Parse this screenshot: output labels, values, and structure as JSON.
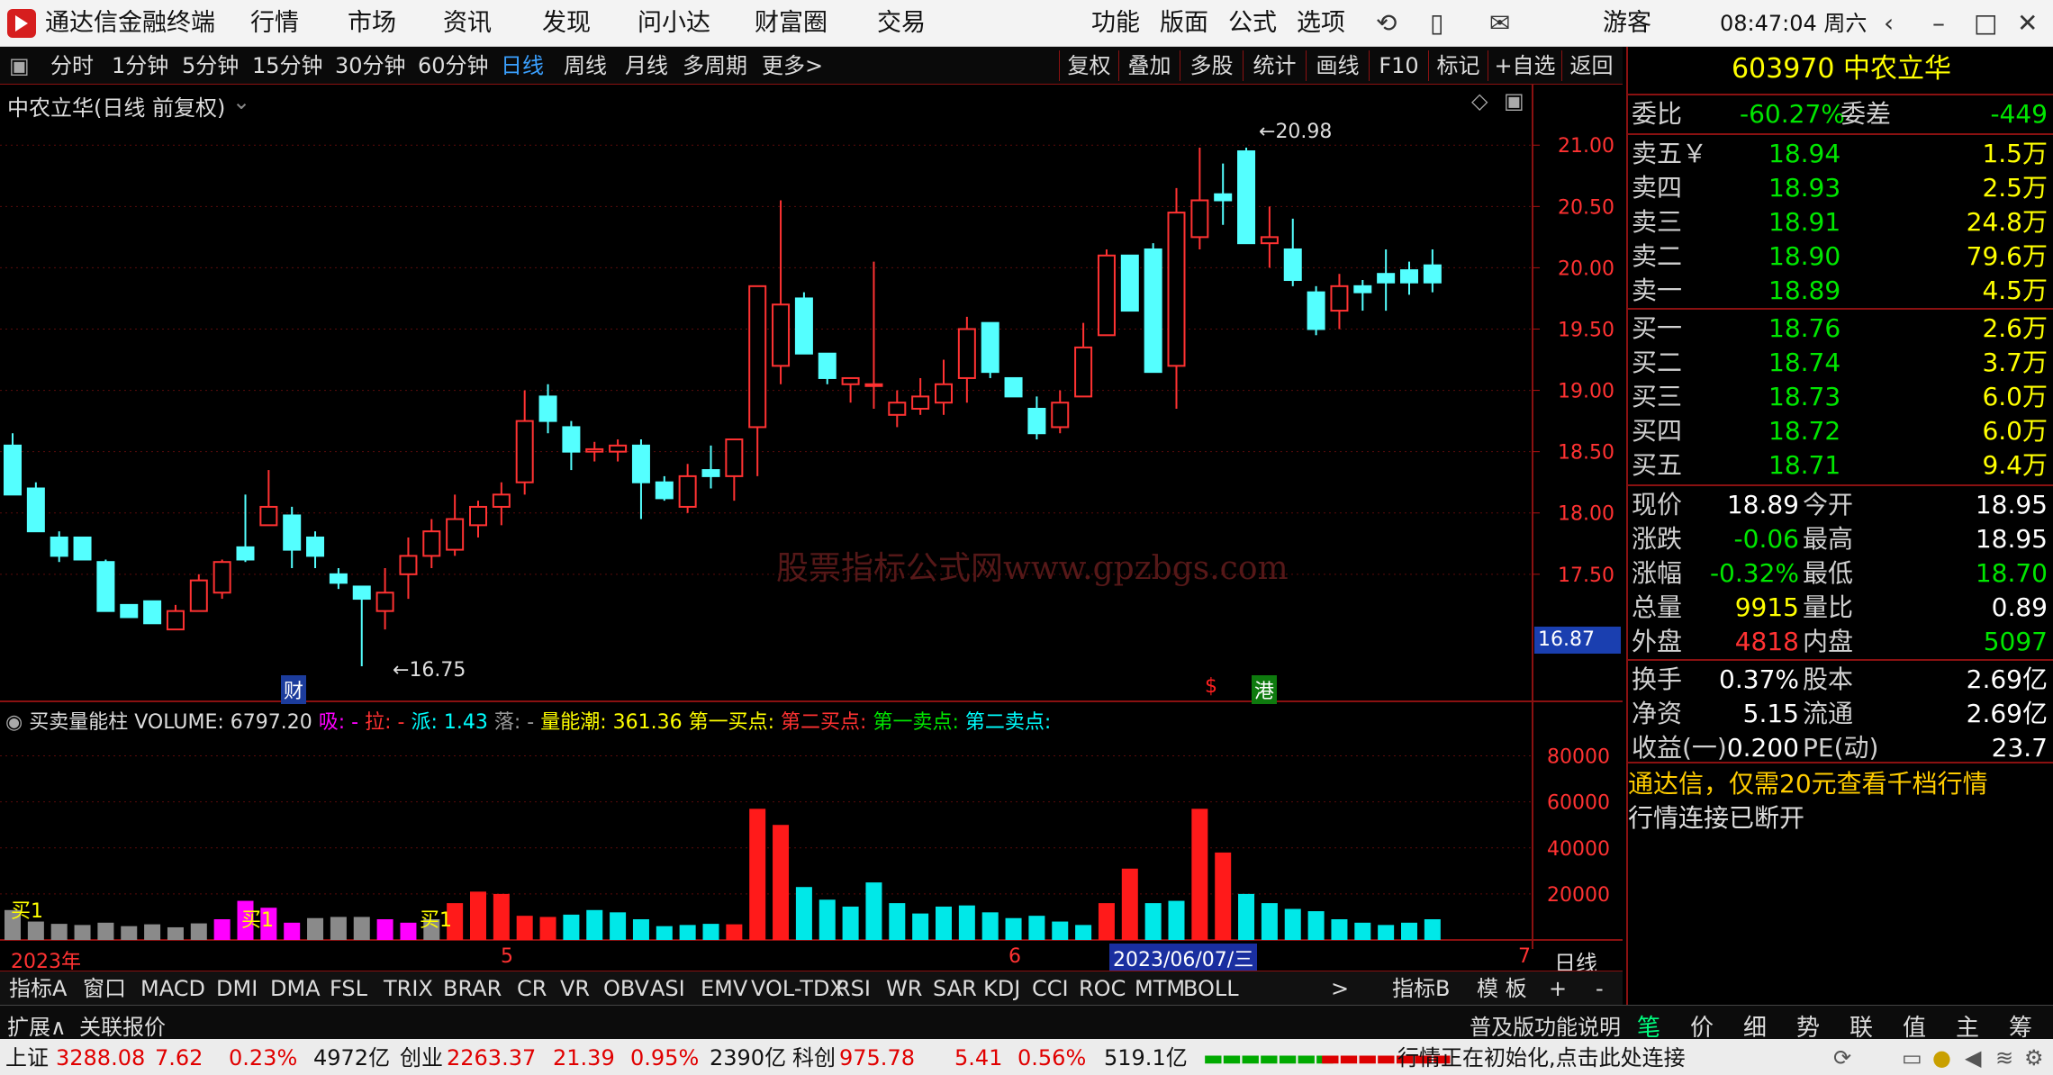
{
  "app": {
    "title": "通达信金融终端",
    "menu": [
      "行情",
      "市场",
      "资讯",
      "发现",
      "问小达",
      "财富圈",
      "交易"
    ],
    "right_menu": [
      "功能",
      "版面",
      "公式",
      "选项"
    ],
    "user": "游客",
    "clock": "08:47:04 周六"
  },
  "toolbar": {
    "periods": [
      "分时",
      "1分钟",
      "5分钟",
      "15分钟",
      "30分钟",
      "60分钟",
      "日线",
      "周线",
      "月线",
      "多周期",
      "更多>"
    ],
    "active_period": "日线",
    "buttons": [
      "复权",
      "叠加",
      "多股",
      "统计",
      "画线",
      "F10",
      "标记",
      "+自选",
      "返回"
    ]
  },
  "chart": {
    "title": "中农立华(日线 前复权)",
    "high_label": "20.98",
    "low_label": "16.75",
    "cursor_price": "16.87",
    "watermark": "股票指标公式网www.gpzbgs.com",
    "markers": {
      "cai": "财",
      "dollar": "$",
      "gang": "港"
    },
    "price_ticks": [
      "21.00",
      "20.50",
      "20.00",
      "19.50",
      "19.00",
      "18.50",
      "18.00",
      "17.50"
    ],
    "volume_ticks": [
      "80000",
      "60000",
      "40000",
      "20000"
    ],
    "date_labels": {
      "year": "2023年",
      "m5": "5",
      "m6": "6",
      "cursor_date": "2023/06/07/三",
      "m7": "7"
    },
    "period_tag": "日线"
  },
  "indicator": {
    "name": "买卖量能柱",
    "volume_label": "VOLUME: 6797.20",
    "xi": "吸: -",
    "la": "拉: -",
    "pai": "派: 1.43",
    "luo": "落: -",
    "lnc": "量能潮: 361.36",
    "b1": "第一买点:",
    "b2": "第二买点:",
    "s1": "第一卖点:",
    "s2": "第二卖点:",
    "buy_tag": "买1"
  },
  "chart_data": {
    "type": "candlestick",
    "title": "中农立华(日线 前复权)",
    "ylim": [
      16.5,
      21.2
    ],
    "candles": [
      {
        "o": 18.55,
        "h": 18.65,
        "l": 18.15,
        "c": 18.15
      },
      {
        "o": 18.2,
        "h": 18.25,
        "l": 17.85,
        "c": 17.85
      },
      {
        "o": 17.8,
        "h": 17.85,
        "l": 17.6,
        "c": 17.65
      },
      {
        "o": 17.8,
        "h": 17.8,
        "l": 17.62,
        "c": 17.62
      },
      {
        "o": 17.6,
        "h": 17.62,
        "l": 17.2,
        "c": 17.2
      },
      {
        "o": 17.25,
        "h": 17.25,
        "l": 17.15,
        "c": 17.15
      },
      {
        "o": 17.28,
        "h": 17.28,
        "l": 17.1,
        "c": 17.1
      },
      {
        "o": 17.05,
        "h": 17.25,
        "l": 17.05,
        "c": 17.2
      },
      {
        "o": 17.2,
        "h": 17.5,
        "l": 17.2,
        "c": 17.45
      },
      {
        "o": 17.35,
        "h": 17.62,
        "l": 17.3,
        "c": 17.6
      },
      {
        "o": 17.72,
        "h": 18.15,
        "l": 17.6,
        "c": 17.62
      },
      {
        "o": 17.9,
        "h": 18.35,
        "l": 17.9,
        "c": 18.05
      },
      {
        "o": 17.98,
        "h": 18.05,
        "l": 17.55,
        "c": 17.7
      },
      {
        "o": 17.8,
        "h": 17.85,
        "l": 17.55,
        "c": 17.65
      },
      {
        "o": 17.5,
        "h": 17.55,
        "l": 17.38,
        "c": 17.43
      },
      {
        "o": 17.4,
        "h": 17.4,
        "l": 16.75,
        "c": 17.3
      },
      {
        "o": 17.2,
        "h": 17.55,
        "l": 17.05,
        "c": 17.35
      },
      {
        "o": 17.5,
        "h": 17.8,
        "l": 17.3,
        "c": 17.65
      },
      {
        "o": 17.65,
        "h": 17.95,
        "l": 17.55,
        "c": 17.85
      },
      {
        "o": 17.7,
        "h": 18.15,
        "l": 17.65,
        "c": 17.95
      },
      {
        "o": 17.9,
        "h": 18.1,
        "l": 17.8,
        "c": 18.05
      },
      {
        "o": 18.05,
        "h": 18.25,
        "l": 17.9,
        "c": 18.15
      },
      {
        "o": 18.25,
        "h": 19.0,
        "l": 18.15,
        "c": 18.75
      },
      {
        "o": 18.95,
        "h": 19.05,
        "l": 18.65,
        "c": 18.75
      },
      {
        "o": 18.7,
        "h": 18.75,
        "l": 18.35,
        "c": 18.5
      },
      {
        "o": 18.5,
        "h": 18.58,
        "l": 18.42,
        "c": 18.52
      },
      {
        "o": 18.5,
        "h": 18.6,
        "l": 18.42,
        "c": 18.55
      },
      {
        "o": 18.55,
        "h": 18.6,
        "l": 17.95,
        "c": 18.25
      },
      {
        "o": 18.25,
        "h": 18.3,
        "l": 18.1,
        "c": 18.12
      },
      {
        "o": 18.05,
        "h": 18.4,
        "l": 18.0,
        "c": 18.3
      },
      {
        "o": 18.35,
        "h": 18.55,
        "l": 18.2,
        "c": 18.3
      },
      {
        "o": 18.3,
        "h": 18.6,
        "l": 18.1,
        "c": 18.6
      },
      {
        "o": 18.7,
        "h": 19.85,
        "l": 18.3,
        "c": 19.85
      },
      {
        "o": 19.2,
        "h": 20.55,
        "l": 19.05,
        "c": 19.7
      },
      {
        "o": 19.75,
        "h": 19.8,
        "l": 19.3,
        "c": 19.3
      },
      {
        "o": 19.3,
        "h": 19.3,
        "l": 19.05,
        "c": 19.1
      },
      {
        "o": 19.05,
        "h": 19.1,
        "l": 18.9,
        "c": 19.1
      },
      {
        "o": 19.05,
        "h": 20.05,
        "l": 18.85,
        "c": 19.05
      },
      {
        "o": 18.8,
        "h": 19.0,
        "l": 18.7,
        "c": 18.9
      },
      {
        "o": 18.85,
        "h": 19.1,
        "l": 18.8,
        "c": 18.95
      },
      {
        "o": 18.9,
        "h": 19.25,
        "l": 18.8,
        "c": 19.05
      },
      {
        "o": 19.1,
        "h": 19.6,
        "l": 18.9,
        "c": 19.5
      },
      {
        "o": 19.55,
        "h": 19.55,
        "l": 19.1,
        "c": 19.15
      },
      {
        "o": 19.1,
        "h": 19.1,
        "l": 18.95,
        "c": 18.95
      },
      {
        "o": 18.85,
        "h": 18.95,
        "l": 18.6,
        "c": 18.65
      },
      {
        "o": 18.7,
        "h": 19.0,
        "l": 18.65,
        "c": 18.9
      },
      {
        "o": 18.95,
        "h": 19.55,
        "l": 18.95,
        "c": 19.35
      },
      {
        "o": 19.45,
        "h": 20.15,
        "l": 19.45,
        "c": 20.1
      },
      {
        "o": 20.1,
        "h": 20.1,
        "l": 19.65,
        "c": 19.65
      },
      {
        "o": 20.15,
        "h": 20.2,
        "l": 19.15,
        "c": 19.15
      },
      {
        "o": 19.2,
        "h": 20.65,
        "l": 18.85,
        "c": 20.45
      },
      {
        "o": 20.25,
        "h": 20.98,
        "l": 20.15,
        "c": 20.55
      },
      {
        "o": 20.6,
        "h": 20.85,
        "l": 20.35,
        "c": 20.55
      },
      {
        "o": 20.95,
        "h": 20.98,
        "l": 20.2,
        "c": 20.2
      },
      {
        "o": 20.2,
        "h": 20.5,
        "l": 20.0,
        "c": 20.25
      },
      {
        "o": 20.15,
        "h": 20.4,
        "l": 19.85,
        "c": 19.9
      },
      {
        "o": 19.8,
        "h": 19.85,
        "l": 19.45,
        "c": 19.5
      },
      {
        "o": 19.65,
        "h": 19.95,
        "l": 19.5,
        "c": 19.85
      },
      {
        "o": 19.85,
        "h": 19.9,
        "l": 19.65,
        "c": 19.8
      },
      {
        "o": 19.95,
        "h": 20.15,
        "l": 19.65,
        "c": 19.88
      },
      {
        "o": 19.98,
        "h": 20.05,
        "l": 19.78,
        "c": 19.88
      },
      {
        "o": 20.02,
        "h": 20.15,
        "l": 19.8,
        "c": 19.88
      }
    ],
    "volume": [
      13000,
      8000,
      7000,
      6500,
      7500,
      6000,
      6800,
      5500,
      7200,
      9000,
      17000,
      14000,
      7500,
      9500,
      10000,
      10000,
      9000,
      7500,
      9000,
      16000,
      21000,
      20000,
      10500,
      10000,
      11000,
      13000,
      12000,
      9000,
      6000,
      6500,
      7000,
      6800,
      57000,
      50000,
      23000,
      17500,
      14500,
      25000,
      16000,
      11500,
      14500,
      15000,
      12000,
      9500,
      10500,
      8000,
      6500,
      16000,
      31000,
      16000,
      17000,
      57000,
      38000,
      20000,
      16000,
      13500,
      12500,
      9000,
      7500,
      6500,
      7500,
      9000
    ],
    "volume_colors": [
      "gray",
      "gray",
      "gray",
      "gray",
      "gray",
      "gray",
      "gray",
      "gray",
      "gray",
      "mag",
      "mag",
      "mag",
      "mag",
      "gray",
      "gray",
      "gray",
      "mag",
      "mag",
      "gray",
      "red",
      "red",
      "red",
      "red",
      "red",
      "cyan",
      "cyan",
      "cyan",
      "cyan",
      "cyan",
      "cyan",
      "cyan",
      "red",
      "red",
      "red",
      "cyan",
      "cyan",
      "cyan",
      "cyan",
      "cyan",
      "cyan",
      "cyan",
      "cyan",
      "cyan",
      "cyan",
      "cyan",
      "cyan",
      "cyan",
      "red",
      "red",
      "cyan",
      "cyan",
      "red",
      "red",
      "cyan",
      "cyan",
      "cyan",
      "cyan",
      "cyan",
      "cyan",
      "cyan",
      "cyan",
      "cyan"
    ],
    "ylim_volume": [
      0,
      90000
    ]
  },
  "quote": {
    "code": "603970",
    "name": "中农立华",
    "wb_label": "委比",
    "wb": "-60.27%",
    "wc_label": "委差",
    "wc": "-449",
    "asks": [
      {
        "l": "卖五￥",
        "p": "18.94",
        "v": "1.5万"
      },
      {
        "l": "卖四",
        "p": "18.93",
        "v": "2.5万"
      },
      {
        "l": "卖三",
        "p": "18.91",
        "v": "24.8万"
      },
      {
        "l": "卖二",
        "p": "18.90",
        "v": "79.6万"
      },
      {
        "l": "卖一",
        "p": "18.89",
        "v": "4.5万"
      }
    ],
    "bids": [
      {
        "l": "买一",
        "p": "18.76",
        "v": "2.6万"
      },
      {
        "l": "买二",
        "p": "18.74",
        "v": "3.7万"
      },
      {
        "l": "买三",
        "p": "18.73",
        "v": "6.0万"
      },
      {
        "l": "买四",
        "p": "18.72",
        "v": "6.0万"
      },
      {
        "l": "买五",
        "p": "18.71",
        "v": "9.4万"
      }
    ],
    "stats": [
      {
        "a": "现价",
        "av": "18.89",
        "b": "今开",
        "bv": "18.95"
      },
      {
        "a": "涨跌",
        "av": "-0.06",
        "b": "最高",
        "bv": "18.95"
      },
      {
        "a": "涨幅",
        "av": "-0.32%",
        "b": "最低",
        "bv": "18.70"
      },
      {
        "a": "总量",
        "av": "9915",
        "b": "量比",
        "bv": "0.89"
      },
      {
        "a": "外盘",
        "av": "4818",
        "b": "内盘",
        "bv": "5097"
      }
    ],
    "stats2": [
      {
        "a": "换手",
        "av": "0.37%",
        "b": "股本",
        "bv": "2.69亿"
      },
      {
        "a": "净资",
        "av": "5.15",
        "b": "流通",
        "bv": "2.69亿"
      },
      {
        "a": "收益(一)",
        "av": "0.200",
        "b": "PE(动)",
        "bv": "23.7"
      }
    ],
    "promo": "通达信，仅需20元查看千档行情",
    "conn": "行情连接已断开",
    "tabs": [
      "笔",
      "价",
      "细",
      "势",
      "联",
      "值",
      "主",
      "筹"
    ]
  },
  "bottom_tabs": [
    "指标A",
    "窗口",
    "MACD",
    "DMI",
    "DMA",
    "FSL",
    "TRIX",
    "BRAR",
    "CR",
    "VR",
    "OBV",
    "ASI",
    "EMV",
    "VOL-TDX",
    "RSI",
    "WR",
    "SAR",
    "KDJ",
    "CCI",
    "ROC",
    "MTM",
    "BOLL",
    ">"
  ],
  "bottom_right": [
    "指标B",
    "模 板",
    "+",
    "-"
  ],
  "ext": {
    "expand": "扩展∧",
    "related": "关联报价",
    "help": "普及版功能说明"
  },
  "status": {
    "sh": "上证",
    "sh_v": "3288.08",
    "sh_c": "7.62",
    "sh_p": "0.23%",
    "sh_a": "4972亿",
    "cy": "创业",
    "cy_v": "2263.37",
    "cy_c": "21.39",
    "cy_p": "0.95%",
    "cy_a": "2390亿",
    "kc": "科创",
    "kc_v": "975.78",
    "kc_c": "5.41",
    "kc_p": "0.56%",
    "kc_a": "519.1亿",
    "msg": "行情正在初始化,点击此处连接"
  }
}
